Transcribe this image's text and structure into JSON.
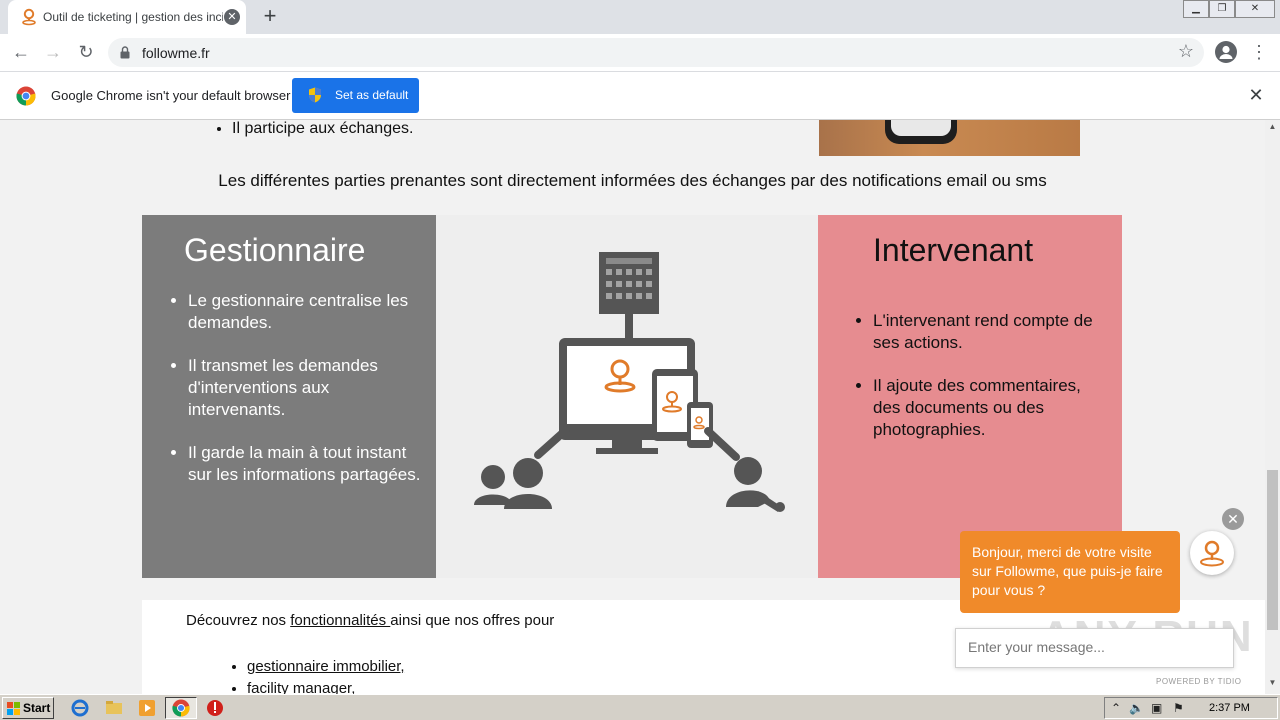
{
  "browser": {
    "tab_title": "Outil de ticketing | gestion des incide",
    "new_tab_icon": "plus-icon",
    "url": "followme.fr",
    "window_controls": [
      "minimize",
      "restore",
      "close"
    ]
  },
  "infobar": {
    "message": "Google Chrome isn't your default browser",
    "button_label": "Set as default"
  },
  "page": {
    "top_bullet": "Il participe aux échanges.",
    "notify_line": "Les différentes parties prenantes sont directement informées des échanges par des notifications email ou sms",
    "gestionnaire": {
      "title": "Gestionnaire",
      "items": [
        "Le gestionnaire centralise les demandes.",
        "Il transmet les demandes d'interventions aux intervenants.",
        "Il garde la main à tout instant sur les informations partagées."
      ]
    },
    "intervenant": {
      "title": "Intervenant",
      "items": [
        "L'intervenant rend compte de ses actions.",
        "Il ajoute des commentaires, des documents ou des photographies."
      ]
    },
    "discover": {
      "prefix": "Découvrez nos ",
      "link": "fonctionnalités ",
      "suffix": " ainsi que nos offres pour"
    },
    "offers": [
      "gestionnaire immobilier,",
      "facility manager,"
    ]
  },
  "chat": {
    "message": "Bonjour, merci de votre visite sur Followme, que puis-je faire pour vous ?",
    "input_placeholder": "Enter your message...",
    "powered_by": "POWERED BY TIDIO",
    "watermark": "ANY RUN"
  },
  "taskbar": {
    "start_label": "Start",
    "clock": "2:37 PM"
  },
  "colors": {
    "accent_blue": "#1a73e8",
    "panel_grey": "#7c7c7c",
    "panel_pink": "#e68c90",
    "chat_orange": "#f08a2a",
    "brand_orange": "#e07b2a"
  }
}
